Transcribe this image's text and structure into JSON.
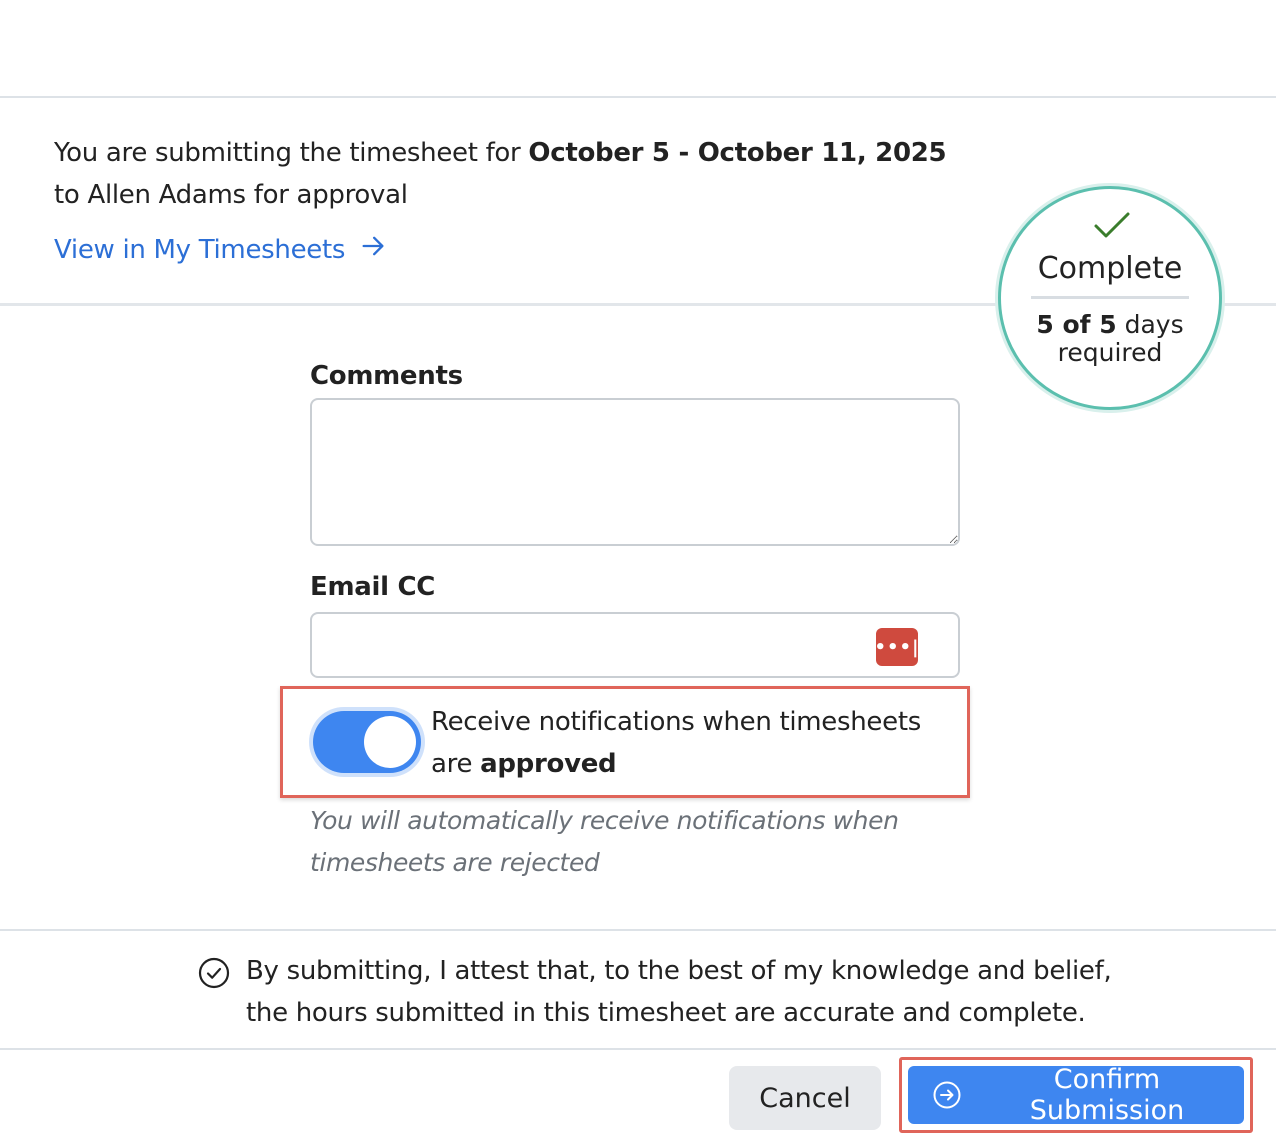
{
  "summary": {
    "prefix": "You are submitting the timesheet for ",
    "period": "October 5 - October 11, 2025",
    "suffix": "to Allen Adams for approval"
  },
  "view_link": {
    "label": "View in My Timesheets",
    "icon": "arrow-right-icon"
  },
  "status": {
    "label": "Complete",
    "count_bold": "5 of 5",
    "count_suffix": " days",
    "count_line2": "required",
    "color": "#5bbfae",
    "check_color": "#3a7d2c"
  },
  "form": {
    "comments_label": "Comments",
    "comments_value": "",
    "email_label": "Email CC",
    "email_value": "",
    "password_manager_icon": "password-manager-icon",
    "password_manager_text": "•••|"
  },
  "notifications": {
    "toggle_on": true,
    "text_prefix": "Receive notifications when timesheets are ",
    "text_bold": "approved",
    "hint": "You will automatically receive notifications when timesheets are rejected"
  },
  "attestation": {
    "icon": "check-circle-icon",
    "text": "By submitting, I attest that, to the best of my knowledge and belief, the hours submitted in this timesheet are accurate and complete."
  },
  "buttons": {
    "cancel": "Cancel",
    "confirm": "Confirm Submission",
    "confirm_icon": "arrow-circle-right-icon",
    "primary_color": "#3e86f0",
    "highlight_color": "#e0655a"
  }
}
